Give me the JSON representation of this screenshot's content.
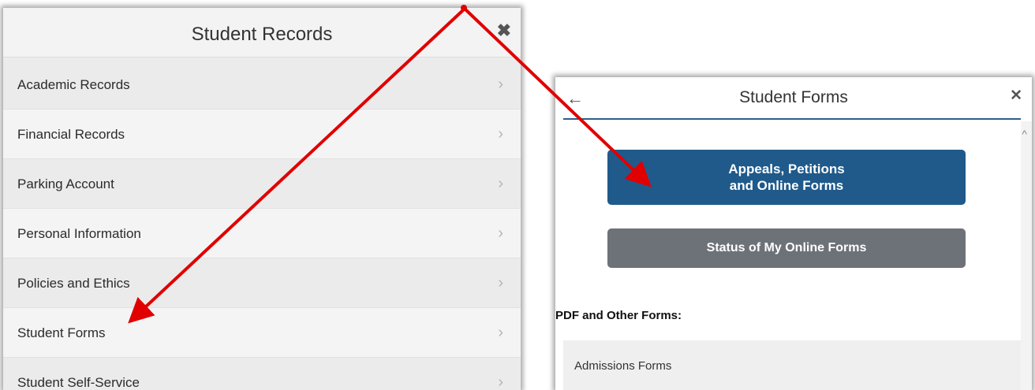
{
  "left_panel": {
    "title": "Student Records",
    "close_glyph": "✖",
    "items": [
      {
        "label": "Academic Records",
        "chevron": "›"
      },
      {
        "label": "Financial Records",
        "chevron": "›"
      },
      {
        "label": "Parking Account",
        "chevron": "›"
      },
      {
        "label": "Personal Information",
        "chevron": "›"
      },
      {
        "label": "Policies and Ethics",
        "chevron": "›"
      },
      {
        "label": "Student Forms",
        "chevron": "›"
      },
      {
        "label": "Student Self-Service",
        "chevron": "›"
      }
    ]
  },
  "right_panel": {
    "back_glyph": "←",
    "title": "Student Forms",
    "close_glyph": "✕",
    "scroll_glyph": "^",
    "primary_button": {
      "line1": "Appeals, Petitions",
      "line2": "and Online Forms"
    },
    "secondary_button": {
      "label": "Status of My Online Forms"
    },
    "section_label": "PDF and Other Forms:",
    "list_items": [
      {
        "label": "Admissions Forms"
      }
    ]
  },
  "colors": {
    "primary": "#1f5a8b",
    "secondary": "#6d7278",
    "arrow": "#e00000",
    "header_rule": "#2c5e8c"
  },
  "annotations": {
    "arrows": [
      {
        "from": "origin-point",
        "to": "student-forms-menu-item"
      },
      {
        "from": "origin-point",
        "to": "appeals-petitions-button"
      }
    ]
  }
}
